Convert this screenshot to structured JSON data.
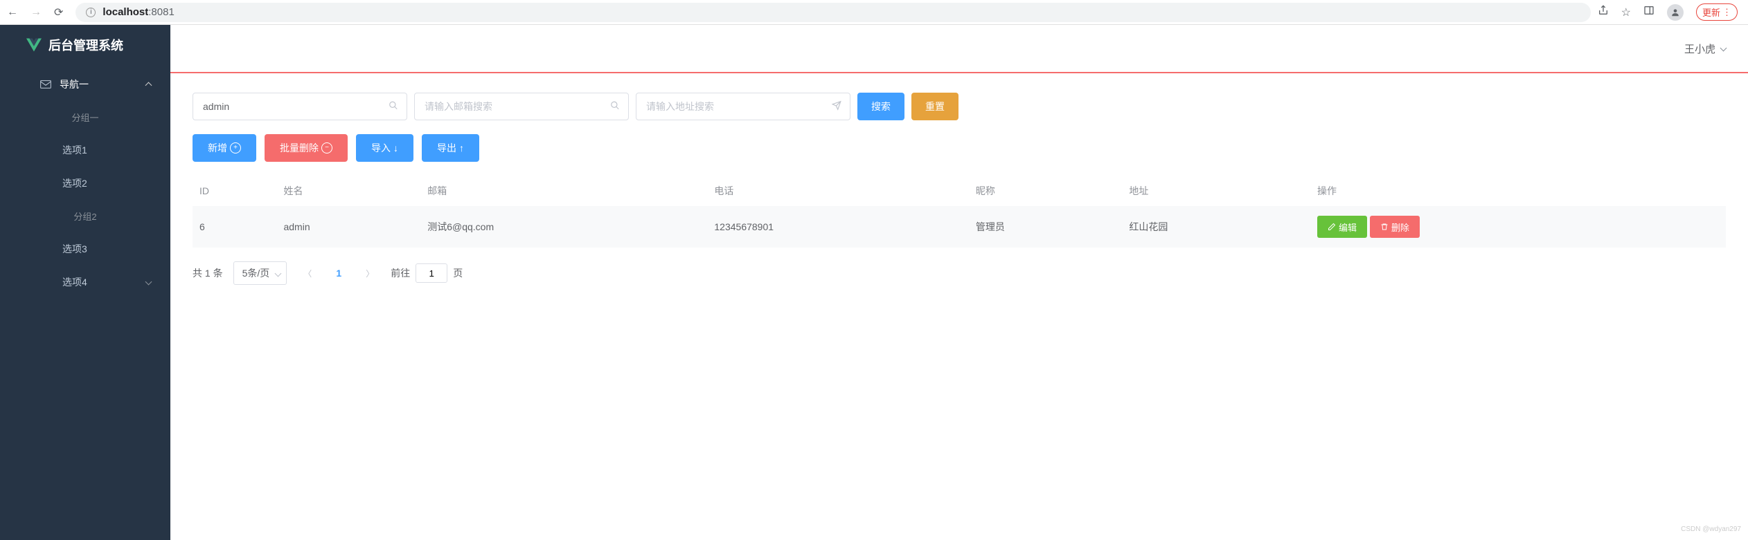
{
  "browser": {
    "url_host": "localhost",
    "url_port": ":8081",
    "update_label": "更新"
  },
  "sidebar": {
    "app_title": "后台管理系统",
    "nav1_label": "导航一",
    "groups": [
      "分组一",
      "分组2"
    ],
    "items": [
      "选项1",
      "选项2",
      "选项3",
      "选项4"
    ]
  },
  "topbar": {
    "username": "王小虎"
  },
  "search": {
    "name_value": "admin",
    "email_placeholder": "请输入邮箱搜索",
    "address_placeholder": "请输入地址搜索",
    "search_btn": "搜索",
    "reset_btn": "重置"
  },
  "actions": {
    "add": "新增",
    "batch_delete": "批量删除",
    "import": "导入",
    "export": "导出"
  },
  "table": {
    "headers": {
      "id": "ID",
      "name": "姓名",
      "email": "邮箱",
      "phone": "电话",
      "nickname": "昵称",
      "address": "地址",
      "action": "操作"
    },
    "rows": [
      {
        "id": "6",
        "name": "admin",
        "email": "测试6@qq.com",
        "phone": "12345678901",
        "nickname": "管理员",
        "address": "红山花园"
      }
    ],
    "edit_btn": "编辑",
    "delete_btn": "删除"
  },
  "pagination": {
    "total_text": "共 1 条",
    "page_size": "5条/页",
    "current": "1",
    "goto_prefix": "前往",
    "goto_value": "1",
    "goto_suffix": "页"
  },
  "watermark": "CSDN @wdyan297"
}
